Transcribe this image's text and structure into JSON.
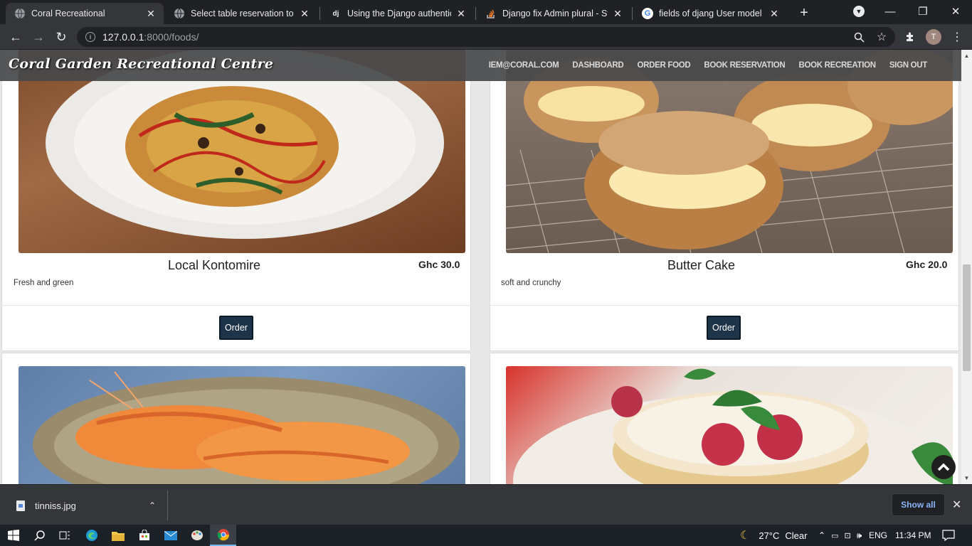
{
  "browser": {
    "tabs": [
      {
        "title": "Coral Recreational",
        "favicon": "globe-icon",
        "active": true
      },
      {
        "title": "Select table reservation to ch",
        "favicon": "globe-icon",
        "active": false
      },
      {
        "title": "Using the Django authenticat",
        "favicon": "django-icon",
        "favicon_text": "dj",
        "active": false
      },
      {
        "title": "Django fix Admin plural - Sta",
        "favicon": "stackoverflow-icon",
        "active": false
      },
      {
        "title": "fields of djang User model - (",
        "favicon": "google-icon",
        "favicon_text": "G",
        "active": false
      }
    ],
    "url_host": "127.0.0.1",
    "url_path": ":8000/foods/",
    "profile_initial": "T"
  },
  "site": {
    "brand": "Coral Garden Recreational Centre",
    "nav": [
      "IEM@CORAL.COM",
      "DASHBOARD",
      "ORDER FOOD",
      "BOOK RESERVATION",
      "BOOK RECREATION",
      "SIGN OUT"
    ]
  },
  "foods": [
    {
      "name": "Local Kontomire",
      "price": "Ghc 30.0",
      "description": "Fresh and green",
      "order_label": "Order",
      "image": "fried-rice-plate"
    },
    {
      "name": "Butter Cake",
      "price": "Ghc 20.0",
      "description": "soft and crunchy",
      "order_label": "Order",
      "image": "cream-puffs"
    },
    {
      "image": "grilled-shrimp"
    },
    {
      "image": "raspberry-pancakes"
    }
  ],
  "downloads": {
    "file": "tinniss.jpg",
    "show_all": "Show all"
  },
  "taskbar": {
    "weather_temp": "27°C",
    "weather_text": "Clear",
    "language": "ENG",
    "time": "11:34 PM"
  },
  "colors": {
    "order_button": "#1d3449",
    "site_nav": "#46484a",
    "chrome_dark": "#202124",
    "chrome_toolbar": "#35363a"
  }
}
